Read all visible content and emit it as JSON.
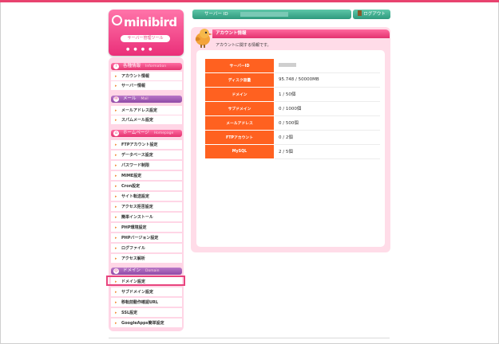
{
  "logo": {
    "brand": "minibird",
    "tagline": "サーバー管理ツール"
  },
  "sidebar": {
    "sections": [
      {
        "title": "各種情報",
        "en": "Information",
        "items": [
          "アカウント情報",
          "サーバー情報"
        ]
      },
      {
        "title": "メール",
        "en": "Mail",
        "items": [
          "メールアドレス設定",
          "スパムメール設定"
        ]
      },
      {
        "title": "ホームページ",
        "en": "Homepage",
        "items": [
          "FTPアカウント設定",
          "データベース設定",
          "パスワード制限",
          "MIME設定",
          "Cron設定",
          "サイト転送設定",
          "アクセス拒否設定",
          "簡単インストール",
          "PHP環境設定",
          "PHPバージョン設定",
          "ログファイル",
          "アクセス解析"
        ]
      },
      {
        "title": "ドメイン",
        "en": "Domain",
        "items": [
          "ドメイン設定",
          "サブドメイン設定",
          "移転前動作確認URL",
          "SSL設定",
          "GoogleApps簡単設定"
        ]
      }
    ]
  },
  "header": {
    "server_id_label": "サーバー ID",
    "server_id_value": "",
    "logout_label": "ログアウト"
  },
  "main": {
    "title": "アカウント情報",
    "description": "アカウントに関する情報です。",
    "rows": [
      {
        "label": "サーバーID",
        "value": ""
      },
      {
        "label": "ディスク容量",
        "value": "95.748 / 50000MB"
      },
      {
        "label": "ドメイン",
        "value": "1 / 50個"
      },
      {
        "label": "サブドメイン",
        "value": "0 / 1000個"
      },
      {
        "label": "メールアドレス",
        "value": "0 / 500個"
      },
      {
        "label": "FTPアカウント",
        "value": "0 / 2個"
      },
      {
        "label": "MySQL",
        "value": "2 / 5個"
      }
    ]
  },
  "colors": {
    "accent": "#e8437d",
    "header_green": "#2f9a7d",
    "table_label": "#ff6120",
    "sidebar_bg": "#ffd6e6"
  }
}
